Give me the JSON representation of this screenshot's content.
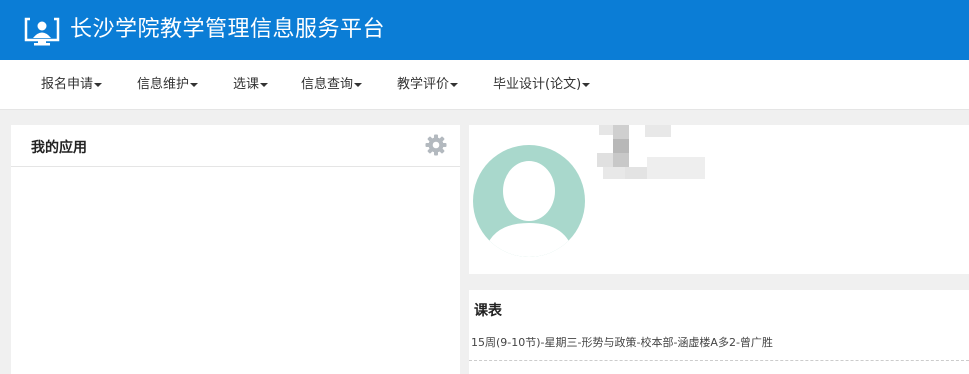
{
  "header": {
    "title": "长沙学院教学管理信息服务平台",
    "logo_icon": "monitor-user-icon",
    "background": "#0b7dd6"
  },
  "nav": {
    "items": [
      {
        "label": "报名申请"
      },
      {
        "label": "信息维护"
      },
      {
        "label": "选课"
      },
      {
        "label": "信息查询"
      },
      {
        "label": "教学评价"
      },
      {
        "label": "毕业设计(论文)"
      }
    ]
  },
  "apps_panel": {
    "title": "我的应用",
    "settings_icon": "gear-icon"
  },
  "profile_panel": {
    "avatar_icon": "default-avatar-icon"
  },
  "schedule_panel": {
    "title": "课表",
    "entries": [
      "15周(9-10节)-星期三-形势与政策-校本部-涵虚楼A多2-曾广胜"
    ]
  }
}
